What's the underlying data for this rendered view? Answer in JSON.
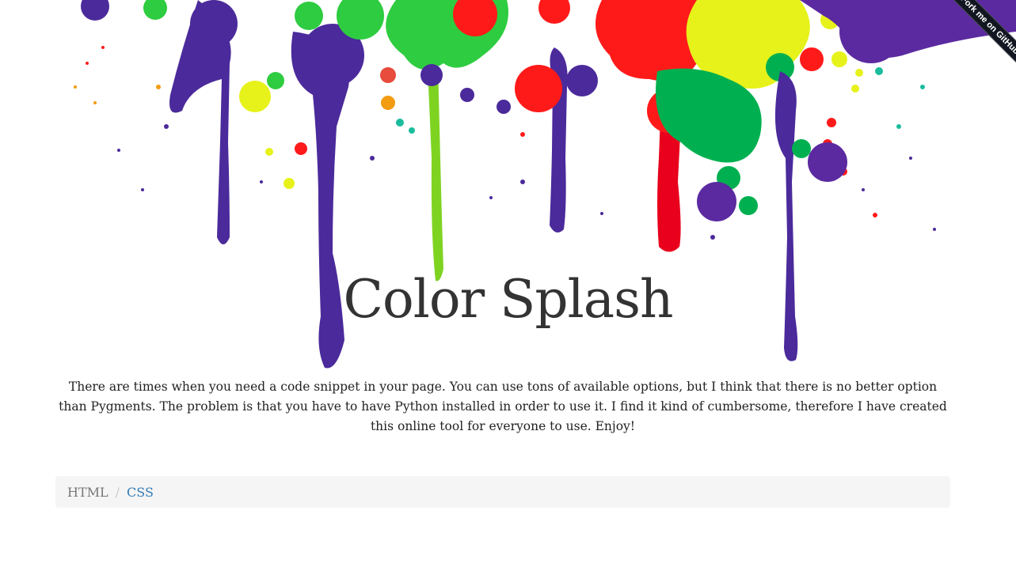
{
  "ribbon": {
    "label": "Fork me on GitHub"
  },
  "header": {
    "title": "Color Splash"
  },
  "intro": {
    "text": "There are times when you need a code snippet in your page. You can use tons of available options, but I think that there is no better option than Pygments. The problem is that you have to have Python installed in order to use it. I find it kind of cumbersome, therefore I have created this online tool for everyone to use. Enjoy!"
  },
  "breadcrumb": {
    "items": [
      {
        "label": "HTML",
        "active": true
      },
      {
        "label": "CSS",
        "active": false
      }
    ],
    "separator": "/"
  },
  "colors": {
    "purple": "#4b2a9b",
    "green": "#2ecc40",
    "lime": "#7ed321",
    "red": "#ff1a1a",
    "yellow": "#e6f21a",
    "emerald": "#00b050",
    "link": "#337ab7",
    "breadcrumb_bg": "#f5f5f5"
  }
}
